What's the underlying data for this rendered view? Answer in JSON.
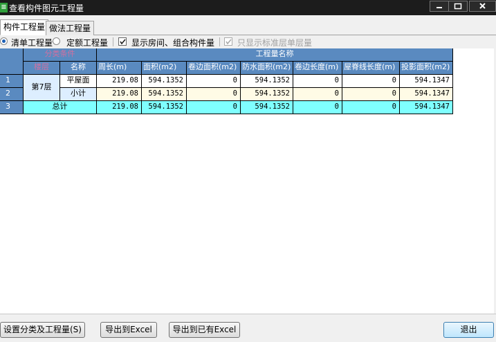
{
  "window": {
    "title": "查看构件图元工程量",
    "app_icon_glyph": "≡",
    "controls": [
      "minimize",
      "maximize",
      "close"
    ]
  },
  "tabs": [
    {
      "label": "构件工程量",
      "active": true
    },
    {
      "label": "做法工程量",
      "active": false
    }
  ],
  "options": {
    "radio_bill": {
      "label": "清单工程量",
      "selected": true
    },
    "radio_quota": {
      "label": "定额工程量",
      "selected": false
    },
    "chk_show_rooms": {
      "label": "显示房间、组合构件量",
      "checked": true
    },
    "chk_standard_floor": {
      "label": "只显示标准层单层量",
      "checked": true,
      "disabled": true
    }
  },
  "table": {
    "group_header_category": "分类条件",
    "group_header_quantity": "工程量名称",
    "col_floor": "楼层",
    "col_name": "名称",
    "columns": [
      "周长(m)",
      "面积(m2)",
      "卷边面积(m2)",
      "防水面积(m2)",
      "卷边长度(m)",
      "屋脊线长度(m)",
      "投影面积(m2)"
    ],
    "rows": [
      {
        "row_no": "1",
        "floor": "第7层",
        "name": "平屋面",
        "values": [
          "219.08",
          "594.1352",
          "0",
          "594.1352",
          "0",
          "0",
          "594.1347"
        ]
      },
      {
        "row_no": "2",
        "floor": "",
        "name": "小计",
        "values": [
          "219.08",
          "594.1352",
          "0",
          "594.1352",
          "0",
          "0",
          "594.1347"
        ]
      },
      {
        "row_no": "3",
        "floor": "",
        "name": "总计",
        "values": [
          "219.08",
          "594.1352",
          "0",
          "594.1352",
          "0",
          "0",
          "594.1347"
        ]
      }
    ]
  },
  "buttons": {
    "settings": "设置分类及工程量(S)",
    "export_excel": "导出到Excel",
    "export_existing": "导出到已有Excel",
    "exit": "退出"
  },
  "colors": {
    "header_bg": "#5a8ac0",
    "header_highlight_text": "#d070a0",
    "total_row_bg": "#7fffff",
    "subtotal_row_bg": "#fffbe6",
    "floor_cell_bg": "#ddeeff"
  }
}
